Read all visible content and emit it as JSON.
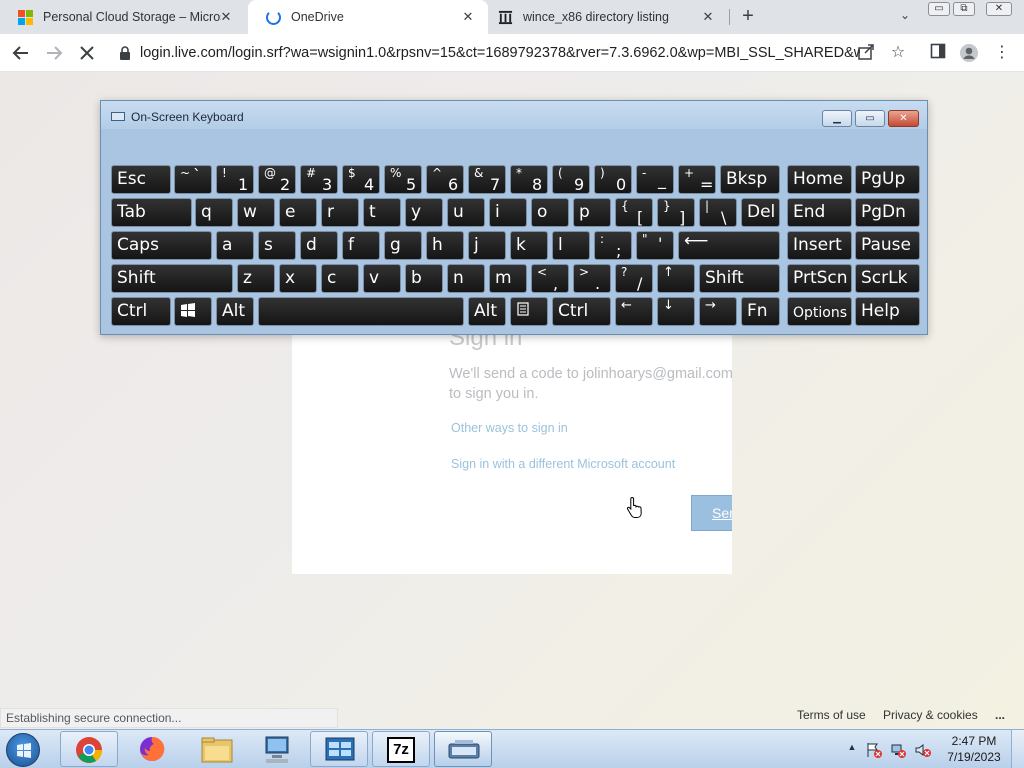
{
  "browser": {
    "tabs": [
      {
        "title": "Personal Cloud Storage – Microsoft",
        "icon": "microsoft-logo-icon"
      },
      {
        "title": "OneDrive",
        "icon": "loading-spinner-icon",
        "active": true
      },
      {
        "title": "wince_x86 directory listing",
        "icon": "library-building-icon"
      }
    ],
    "new_tab": "+",
    "tab_menu": "⌄",
    "window_controls": {
      "minimize": "▭",
      "restore": "⧉",
      "close": "✕"
    },
    "url": "login.live.com/login.srf?wa=wsignin1.0&rpsnv=15&ct=1689792378&rver=7.3.6962.0&wp=MBI_SSL_SHARED&w...",
    "status": "Establishing secure connection..."
  },
  "page": {
    "heading": "Sign in",
    "message": "We'll send a code to jolinhoarys@gmail.com to sign you in.",
    "other_ways": "Other ways to sign in",
    "different_account": "Sign in with a different Microsoft account",
    "send_button": "Send code",
    "footer": {
      "terms": "Terms of use",
      "privacy": "Privacy & cookies",
      "more": "..."
    }
  },
  "osk": {
    "title": "On-Screen Keyboard",
    "keys": {
      "esc": "Esc",
      "tilde_sh": "~",
      "tilde_ch": "`",
      "d1s": "!",
      "d1": "1",
      "d2s": "@",
      "d2": "2",
      "d3s": "#",
      "d3": "3",
      "d4s": "$",
      "d4": "4",
      "d5s": "%",
      "d5": "5",
      "d6s": "^",
      "d6": "6",
      "d7s": "&",
      "d7": "7",
      "d8s": "*",
      "d8": "8",
      "d9s": "(",
      "d9": "9",
      "d0s": ")",
      "d0": "0",
      "minus_sh": "-",
      "minus_ch": "_",
      "plus_sh": "+",
      "plus_ch": "=",
      "bksp": "Bksp",
      "home": "Home",
      "pgup": "PgUp",
      "tab": "Tab",
      "q": "q",
      "w": "w",
      "e": "e",
      "r": "r",
      "t": "t",
      "y": "y",
      "u": "u",
      "i": "i",
      "o": "o",
      "p": "p",
      "lbr_sh": "{",
      "lbr": "[",
      "rbr_sh": "}",
      "rbr": "]",
      "bsl_sh": "|",
      "bsl": "\\",
      "del": "Del",
      "end": "End",
      "pgdn": "PgDn",
      "caps": "Caps",
      "a": "a",
      "s": "s",
      "d": "d",
      "f": "f",
      "g": "g",
      "h": "h",
      "j": "j",
      "k": "k",
      "l": "l",
      "semi_sh": ":",
      "semi": ";",
      "quote_sh": "\"",
      "quote": "'",
      "enter": "⟵",
      "insert": "Insert",
      "pause": "Pause",
      "shift": "Shift",
      "z": "z",
      "x": "x",
      "c": "c",
      "v": "v",
      "b": "b",
      "n": "n",
      "m": "m",
      "comma_sh": "<",
      "comma": ",",
      "period_sh": ">",
      "period": ".",
      "slash_sh": "?",
      "slash": "/",
      "up": "↑",
      "shift_r": "Shift",
      "prtscn": "PrtScn",
      "scrlk": "ScrLk",
      "ctrl": "Ctrl",
      "alt": "Alt",
      "alt_r": "Alt",
      "ctrl_r": "Ctrl",
      "left": "←",
      "down": "↓",
      "right": "→",
      "fn": "Fn",
      "options": "Options",
      "help": "Help"
    }
  },
  "taskbar": {
    "time": "2:47 PM",
    "date": "7/19/2023",
    "show_hidden": "▲",
    "apps": [
      "start-orb-icon",
      "chrome-icon",
      "firefox-icon",
      "file-explorer-icon",
      "computer-network-icon",
      "control-panel-icon",
      "7zip-icon",
      "on-screen-keyboard-icon"
    ],
    "app_label_7z": "7z"
  },
  "colors": {
    "tab_strip": "#dfe3e8",
    "link": "#9ac3dc",
    "keyboard_frame": "#a9c5e2",
    "taskbar": "#cfe0f3"
  }
}
